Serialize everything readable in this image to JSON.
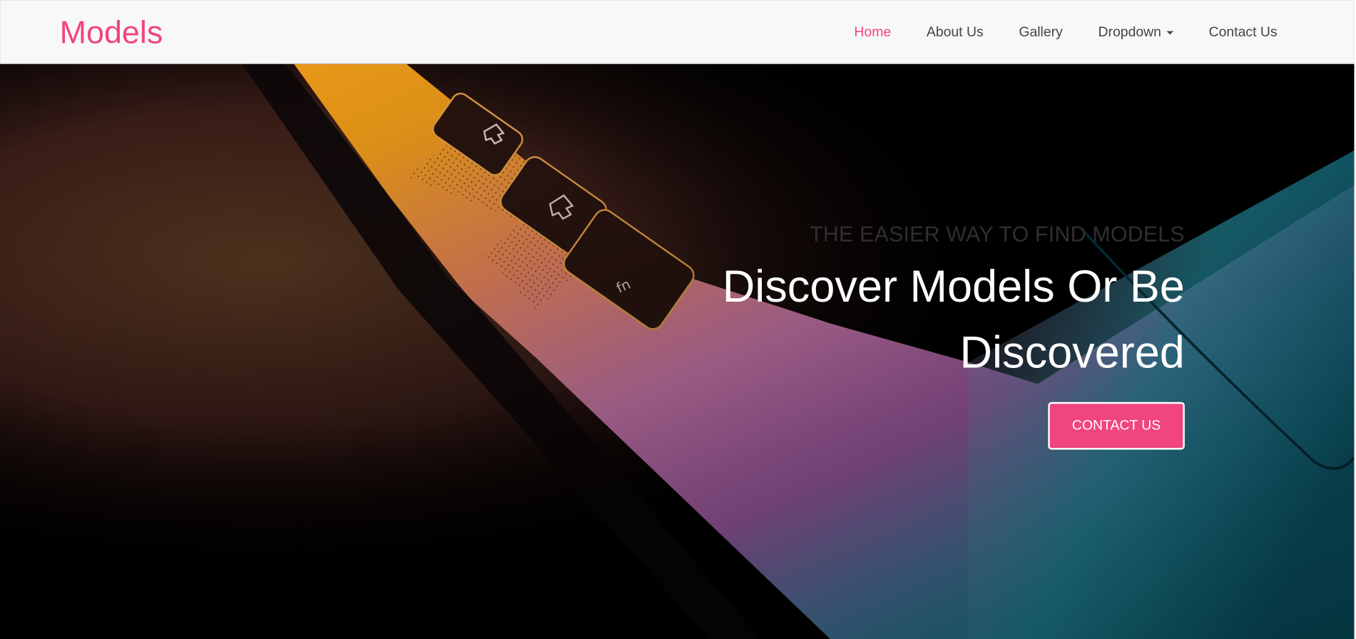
{
  "brand": {
    "name": "Models"
  },
  "nav": {
    "items": [
      {
        "label": "Home",
        "active": true
      },
      {
        "label": "About Us"
      },
      {
        "label": "Gallery"
      },
      {
        "label": "Dropdown",
        "has_caret": true
      },
      {
        "label": "Contact Us"
      }
    ]
  },
  "hero": {
    "tagline": "THE EASIER WAY TO FIND MODELS",
    "headline": "Discover Models Or Be Discovered",
    "cta_label": "CONTACT US"
  },
  "colors": {
    "accent": "#f0457f",
    "navbar_bg": "#f8f8f8",
    "nav_text": "#444444"
  }
}
